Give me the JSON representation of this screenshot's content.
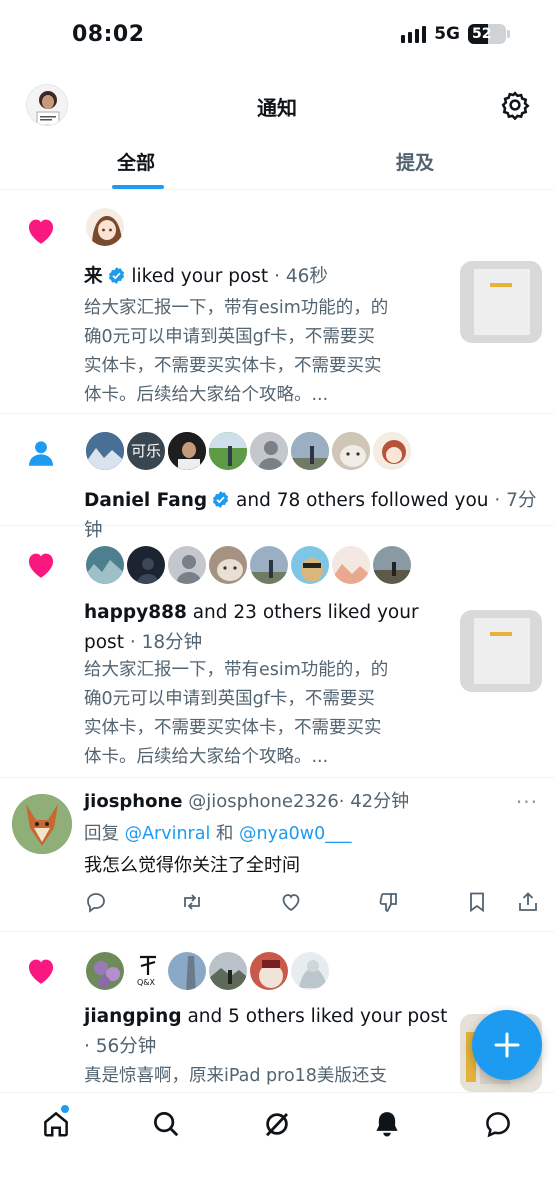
{
  "status_bar": {
    "time": "08:02",
    "network": "5G",
    "battery": "52"
  },
  "header": {
    "title": "通知",
    "settings_icon": "gear-icon"
  },
  "tabs": [
    {
      "label": "全部",
      "active": true
    },
    {
      "label": "提及",
      "active": false
    }
  ],
  "notifications": [
    {
      "type": "like",
      "actor": "来",
      "action": "liked your post",
      "time": "· 46秒",
      "body_lines": [
        "给大家汇报一下，带有esim功能的，的",
        "确0元可以申请到英国gf卡，不需要买",
        "实体卡，不需要买实体卡，不需要买实",
        "体卡。后续给大家给个攻略。..."
      ]
    },
    {
      "type": "follow",
      "actor": "Daniel Fang",
      "action": "and 78 others followed you",
      "time": "· 7分钟",
      "avatar_text": "可乐"
    },
    {
      "type": "like",
      "actor": "happy888",
      "action": "and 23 others liked your",
      "action2": "post",
      "time": "· 18分钟",
      "body_lines": [
        "给大家汇报一下，带有esim功能的，的",
        "确0元可以申请到英国gf卡，不需要买",
        "实体卡，不需要买实体卡，不需要买实",
        "体卡。后续给大家给个攻略。..."
      ]
    },
    {
      "type": "tweet",
      "name": "jiosphone",
      "handle": "@jiosphone2326",
      "time": "· 42分钟",
      "reply_prefix": "回复",
      "reply_user1": "@Arvinral",
      "reply_and": "和",
      "reply_user2": "@nya0w0___",
      "text": "我怎么觉得你关注了全时间",
      "more": "···"
    },
    {
      "type": "like",
      "actor": "jiangping",
      "action": "and 5 others liked your post",
      "time": "· 56分钟",
      "body_lines": [
        "真是惊喜啊，原来iPad pro18美版还支"
      ],
      "avatar_text": "Q&X"
    }
  ],
  "fab_icon": "plus-icon",
  "bottom_nav": [
    "home-icon",
    "search-icon",
    "grok-icon",
    "bell-icon",
    "chat-icon"
  ],
  "colors": {
    "accent": "#1d9bf0",
    "like": "#f91880",
    "text": "#0f1419",
    "muted": "#536471"
  }
}
